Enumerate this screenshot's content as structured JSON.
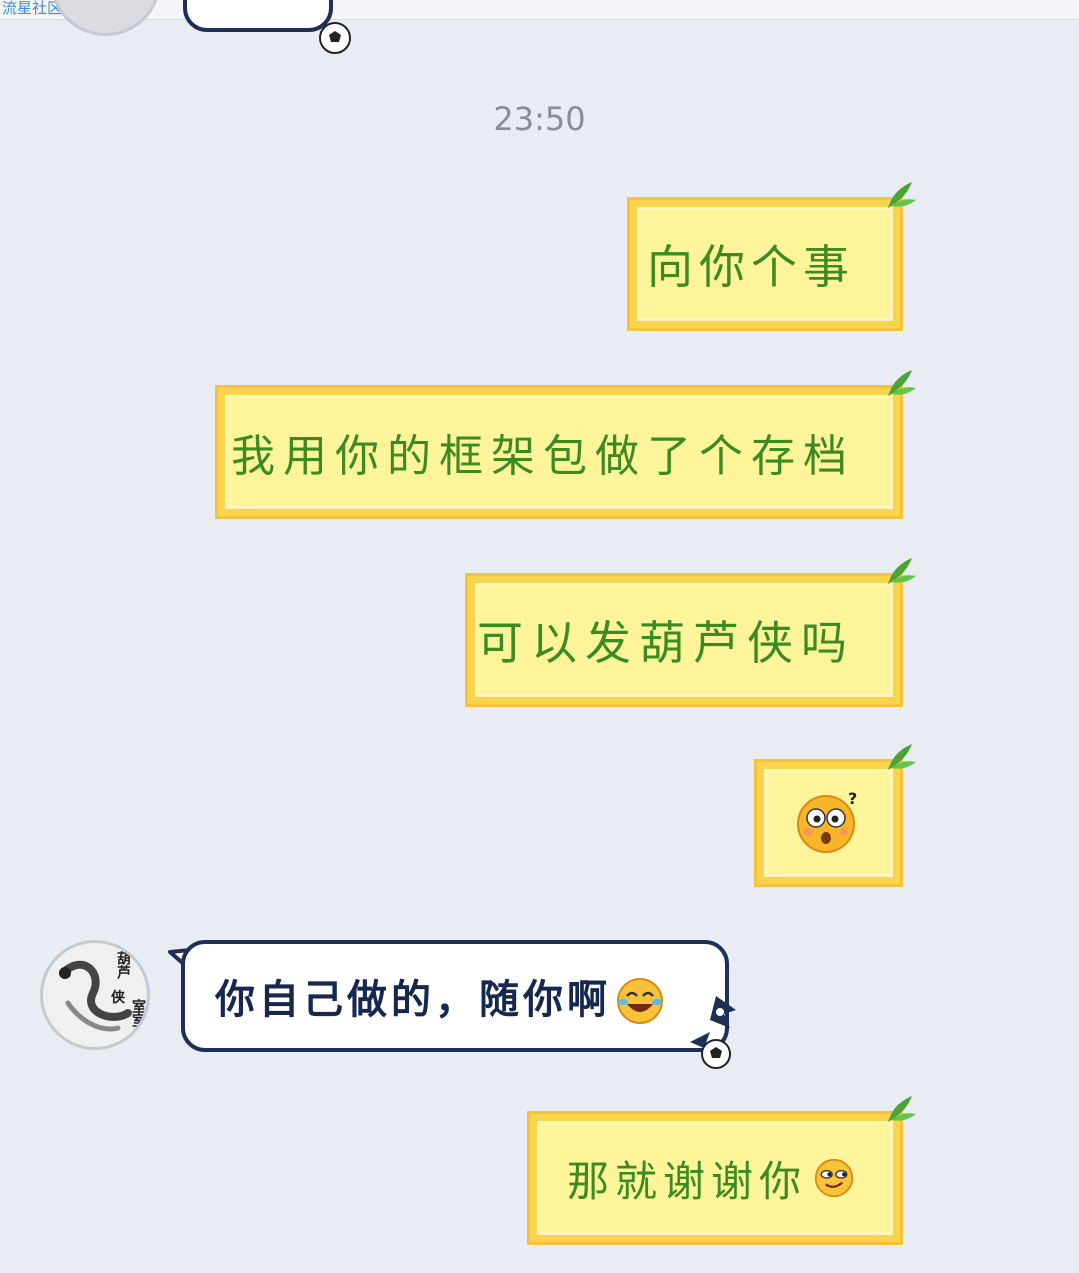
{
  "watermark": "流星社区",
  "timestamp": "23:50",
  "messages": [
    {
      "side": "right",
      "text": "向你个事",
      "emoji": null
    },
    {
      "side": "right",
      "text": "我用你的框架包做了个存档",
      "emoji": null
    },
    {
      "side": "right",
      "text": "可以发葫芦侠吗",
      "emoji": null
    },
    {
      "side": "right",
      "text": "",
      "emoji": "surprised-face-icon"
    },
    {
      "side": "left",
      "text": "你自己做的，随你啊",
      "emoji": "laugh-cry-icon"
    },
    {
      "side": "right",
      "text": "那就谢谢你",
      "emoji": "smirk-face-icon"
    }
  ],
  "avatar": {
    "line1": "葫芦",
    "line2": "侠",
    "line3": "室室"
  },
  "colors": {
    "background": "#eaecf3",
    "sent_bubble": "#fef59a",
    "sent_border": "#fbd44e",
    "sent_text": "#3e8a22",
    "received_border": "#1f2f55",
    "received_text": "#17284e"
  }
}
